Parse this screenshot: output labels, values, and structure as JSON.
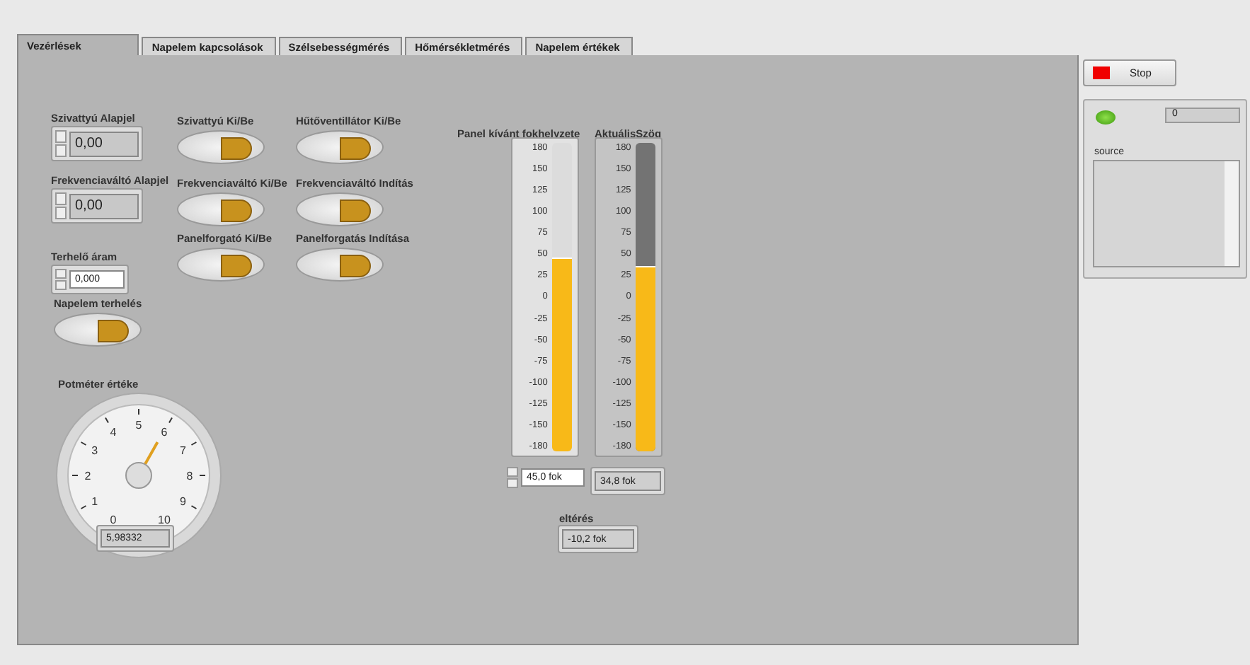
{
  "tabs": [
    {
      "label": "Vezérlések",
      "selected": true
    },
    {
      "label": "Napelem kapcsolások",
      "selected": false
    },
    {
      "label": "Szélsebességmérés",
      "selected": false
    },
    {
      "label": "Hőmérsékletmérés",
      "selected": false
    },
    {
      "label": "Napelem értékek",
      "selected": false
    }
  ],
  "numerics": [
    {
      "label": "Szivattyú Alapjel",
      "value": "0,00",
      "kind": "display"
    },
    {
      "label": "Frekvenciaváltó Alapjel",
      "value": "0,00",
      "kind": "display"
    },
    {
      "label": "Terhelő áram",
      "value": "0,000",
      "kind": "entry"
    }
  ],
  "switches": [
    {
      "label": "Napelem terhelés"
    },
    {
      "label": "Szivattyú Ki/Be"
    },
    {
      "label": "Hűtőventillátor Ki/Be"
    },
    {
      "label": "Frekvenciaváltó Ki/Be"
    },
    {
      "label": "Frekvenciaváltó Indítás"
    },
    {
      "label": "Panelforgató Ki/Be"
    },
    {
      "label": "Panelforgatás Indítása"
    }
  ],
  "gauge": {
    "label": "Potméter értéke",
    "ticks": [
      "0",
      "1",
      "2",
      "3",
      "4",
      "5",
      "6",
      "7",
      "8",
      "9",
      "10"
    ],
    "value": "5,98332"
  },
  "sliders": [
    {
      "label": "Panel kívánt fokhelyzete",
      "kind": "control",
      "level": 0.625,
      "value": "45,0 fok",
      "ticks": [
        "180",
        "150",
        "125",
        "100",
        "75",
        "50",
        "25",
        "0",
        "-25",
        "-50",
        "-75",
        "-100",
        "-125",
        "-150",
        "-180"
      ]
    },
    {
      "label": "AktuálisSzög",
      "kind": "indicator",
      "level": 0.597,
      "value": "34,8 fok",
      "ticks": [
        "180",
        "150",
        "125",
        "100",
        "75",
        "50",
        "25",
        "0",
        "-25",
        "-50",
        "-75",
        "-100",
        "-125",
        "-150",
        "-180"
      ]
    }
  ],
  "difference": {
    "label": "eltérés",
    "value": "-10,2 fok"
  },
  "stop_button": {
    "label": "Stop"
  },
  "status": {
    "led_on": true,
    "count": "0",
    "source_label": "source"
  }
}
